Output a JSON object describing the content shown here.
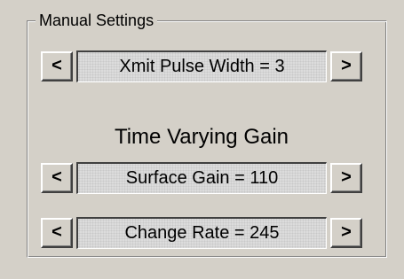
{
  "group": {
    "title": "Manual Settings"
  },
  "xmit_pulse_width": {
    "left_label": "<",
    "value_label": "Xmit Pulse Width = 3",
    "right_label": ">"
  },
  "tvg": {
    "heading": "Time Varying Gain"
  },
  "surface_gain": {
    "left_label": "<",
    "value_label": "Surface Gain = 110",
    "right_label": ">"
  },
  "change_rate": {
    "left_label": "<",
    "value_label": "Change Rate = 245",
    "right_label": ">"
  }
}
